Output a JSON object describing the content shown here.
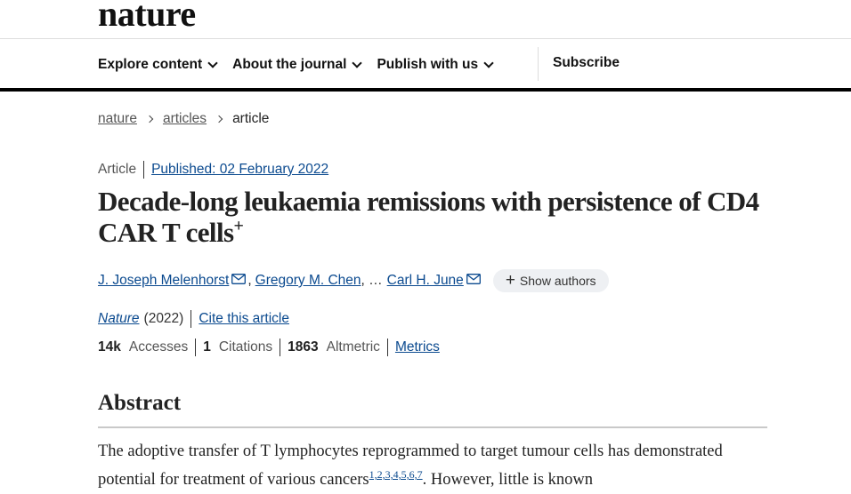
{
  "header": {
    "logo": "nature",
    "nav": [
      "Explore content",
      "About the journal",
      "Publish with us"
    ],
    "subscribe": "Subscribe"
  },
  "breadcrumb": {
    "items": [
      "nature",
      "articles"
    ],
    "current": "article"
  },
  "article": {
    "type": "Article",
    "published": "Published: 02 February 2022",
    "title": "Decade-long leukaemia remissions with persistence of CD4 CAR T cells",
    "title_mark": "+",
    "authors": [
      "J. Joseph Melenhorst",
      "Gregory M. Chen",
      "Carl H. June"
    ],
    "author_sep_1": ",",
    "author_ellipsis": ", …",
    "show_authors": "Show authors",
    "journal": "Nature",
    "year": "(2022)",
    "cite": "Cite this article",
    "metrics": {
      "accesses_value": "14k",
      "accesses_label": "Accesses",
      "citations_value": "1",
      "citations_label": "Citations",
      "altmetric_value": "1863",
      "altmetric_label": "Altmetric",
      "metrics_link": "Metrics"
    }
  },
  "abstract": {
    "heading": "Abstract",
    "text_a": "The adoptive transfer of T lymphocytes reprogrammed to target tumour cells has demonstrated potential for treatment of various cancers",
    "refs": "1,2,3,4,5,6,7",
    "text_b": ". However, little is known"
  }
}
